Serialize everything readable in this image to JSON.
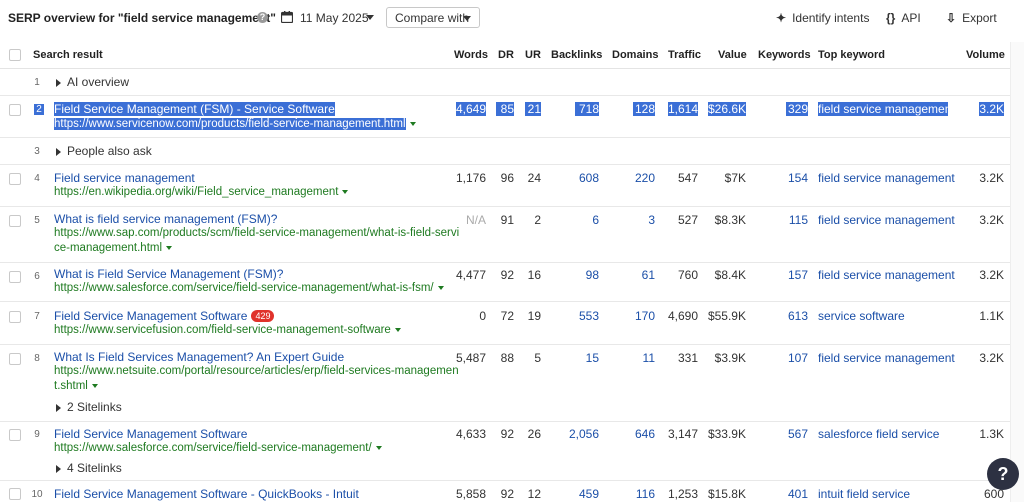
{
  "header": {
    "title": "SERP overview for \"field service management\"",
    "date": "11 May 2025",
    "compare_label": "Compare with",
    "identify_label": "Identify intents",
    "api_label": "API",
    "export_label": "Export"
  },
  "columns": {
    "search_result": "Search result",
    "words": "Words",
    "dr": "DR",
    "ur": "UR",
    "backlinks": "Backlinks",
    "domains": "Domains",
    "traffic": "Traffic",
    "value": "Value",
    "keywords": "Keywords",
    "top_keyword": "Top keyword",
    "volume": "Volume"
  },
  "rows": [
    {
      "num": "1",
      "label": "AI overview"
    },
    {
      "num": "2",
      "title": "Field Service Management (FSM) - Service Software",
      "url": "https://www.servicenow.com/products/field-service-management.html",
      "words": "4,649",
      "dr": "85",
      "ur": "21",
      "backlinks": "718",
      "domains": "128",
      "traffic": "1,614",
      "value": "$26.6K",
      "keywords": "329",
      "top_keyword": "field service management",
      "volume": "3.2K"
    },
    {
      "num": "3",
      "label": "People also ask"
    },
    {
      "num": "4",
      "title": "Field service management",
      "url": "https://en.wikipedia.org/wiki/Field_service_management",
      "words": "1,176",
      "dr": "96",
      "ur": "24",
      "backlinks": "608",
      "domains": "220",
      "traffic": "547",
      "value": "$7K",
      "keywords": "154",
      "top_keyword": "field service management",
      "volume": "3.2K"
    },
    {
      "num": "5",
      "title": "What is field service management (FSM)?",
      "url1": "https://www.sap.com/products/scm/field-service-management/what-is-field-servi",
      "url2": "ce-management.html",
      "words": "N/A",
      "dr": "91",
      "ur": "2",
      "backlinks": "6",
      "domains": "3",
      "traffic": "527",
      "value": "$8.3K",
      "keywords": "115",
      "top_keyword": "field service management",
      "volume": "3.2K"
    },
    {
      "num": "6",
      "title": "What is Field Service Management (FSM)?",
      "url": "https://www.salesforce.com/service/field-service-management/what-is-fsm/",
      "words": "4,477",
      "dr": "92",
      "ur": "16",
      "backlinks": "98",
      "domains": "61",
      "traffic": "760",
      "value": "$8.4K",
      "keywords": "157",
      "top_keyword": "field service management",
      "volume": "3.2K"
    },
    {
      "num": "7",
      "title": "Field Service Management Software",
      "badge": "429",
      "url": "https://www.servicefusion.com/field-service-management-software",
      "words": "0",
      "dr": "72",
      "ur": "19",
      "backlinks": "553",
      "domains": "170",
      "traffic": "4,690",
      "value": "$55.9K",
      "keywords": "613",
      "top_keyword": "service software",
      "volume": "1.1K"
    },
    {
      "num": "8",
      "title": "What Is Field Services Management? An Expert Guide",
      "url1": "https://www.netsuite.com/portal/resource/articles/erp/field-services-managemen",
      "url2": "t.shtml",
      "sitelinks": "2 Sitelinks",
      "words": "5,487",
      "dr": "88",
      "ur": "5",
      "backlinks": "15",
      "domains": "11",
      "traffic": "331",
      "value": "$3.9K",
      "keywords": "107",
      "top_keyword": "field service management",
      "volume": "3.2K"
    },
    {
      "num": "9",
      "title": "Field Service Management Software",
      "url": "https://www.salesforce.com/service/field-service-management/",
      "sitelinks": "4 Sitelinks",
      "words": "4,633",
      "dr": "92",
      "ur": "26",
      "backlinks": "2,056",
      "domains": "646",
      "traffic": "3,147",
      "value": "$33.9K",
      "keywords": "567",
      "top_keyword": "salesforce field service",
      "volume": "1.3K"
    },
    {
      "num": "10",
      "title": "Field Service Management Software - QuickBooks - Intuit",
      "words": "5,858",
      "dr": "92",
      "ur": "12",
      "backlinks": "459",
      "domains": "116",
      "traffic": "1,253",
      "value": "$15.8K",
      "keywords": "401",
      "top_keyword": "intuit field service",
      "volume": "600"
    }
  ],
  "help_glyph": "?",
  "icons": {
    "calendar": "calendar-icon",
    "identify": "sparkle-icon",
    "api": "braces-icon",
    "export": "export-icon",
    "help": "question-icon"
  }
}
